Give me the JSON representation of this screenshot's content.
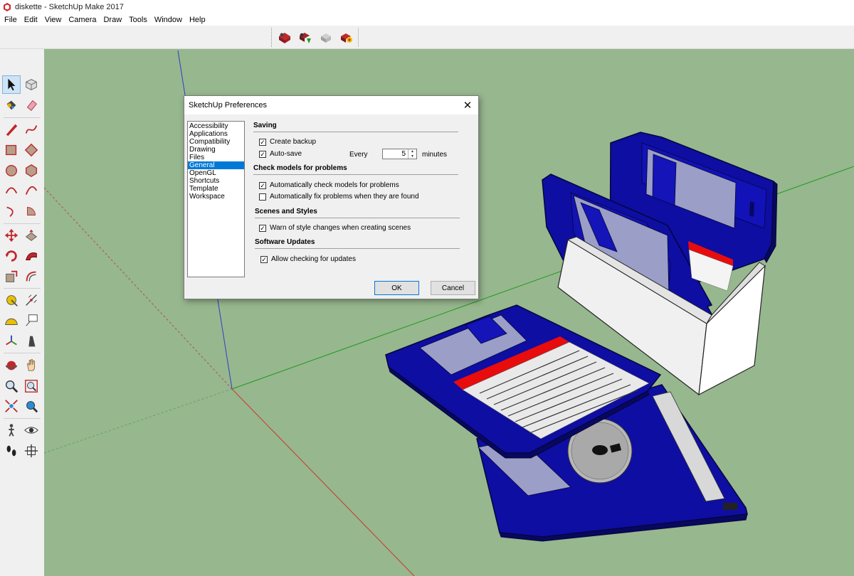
{
  "window": {
    "title": "diskette - SketchUp Make 2017"
  },
  "menu": [
    "File",
    "Edit",
    "View",
    "Camera",
    "Draw",
    "Tools",
    "Window",
    "Help"
  ],
  "top_toolbar": {
    "icons": [
      "warehouse-icon",
      "share-model-icon",
      "share-component-icon",
      "extension-warehouse-icon"
    ]
  },
  "tool_palette": {
    "rows": [
      [
        "select-icon",
        "make-component-icon"
      ],
      [
        "paint-bucket-icon",
        "eraser-icon"
      ],
      "sep",
      [
        "pencil-line-icon",
        "freehand-icon"
      ],
      [
        "rectangle-icon",
        "rotated-rectangle-icon"
      ],
      [
        "circle-icon",
        "polygon-icon"
      ],
      [
        "arc-icon",
        "two-point-arc-icon"
      ],
      [
        "three-point-arc-icon",
        "pie-icon"
      ],
      "sep",
      [
        "move-icon",
        "push-pull-icon"
      ],
      [
        "rotate-icon",
        "follow-me-icon"
      ],
      [
        "scale-icon",
        "offset-icon"
      ],
      "sep",
      [
        "tape-measure-icon",
        "dimension-icon"
      ],
      [
        "protractor-icon",
        "text-icon"
      ],
      [
        "axes-icon",
        "3d-text-icon"
      ],
      "sep",
      [
        "orbit-icon",
        "pan-icon"
      ],
      [
        "zoom-icon",
        "zoom-window-icon"
      ],
      [
        "zoom-extents-icon",
        "previous-view-icon"
      ],
      "sep",
      [
        "walk-icon",
        "look-around-icon"
      ],
      [
        "footprints-icon",
        "section-plane-icon"
      ]
    ]
  },
  "dialog": {
    "title": "SketchUp Preferences",
    "close_glyph": "✕",
    "categories": [
      "Accessibility",
      "Applications",
      "Compatibility",
      "Drawing",
      "Files",
      "General",
      "OpenGL",
      "Shortcuts",
      "Template",
      "Workspace"
    ],
    "selected_category": "General",
    "sections": {
      "saving": {
        "title": "Saving",
        "create_backup": {
          "label": "Create backup",
          "checked": true
        },
        "auto_save": {
          "label": "Auto-save",
          "checked": true
        },
        "every_label": "Every",
        "every_value": "5",
        "minutes_label": "minutes"
      },
      "check_models": {
        "title": "Check models for problems",
        "auto_check": {
          "label": "Automatically check models for problems",
          "checked": true
        },
        "auto_fix": {
          "label": "Automatically fix problems when they are found",
          "checked": false
        }
      },
      "scenes_styles": {
        "title": "Scenes and Styles",
        "warn_style": {
          "label": "Warn of style changes when creating scenes",
          "checked": true
        }
      },
      "software_updates": {
        "title": "Software Updates",
        "allow_updates": {
          "label": "Allow checking for updates",
          "checked": true
        }
      }
    },
    "ok_label": "OK",
    "cancel_label": "Cancel"
  },
  "colors": {
    "viewport_bg": "#97b78e",
    "disk_blue": "#0e0ea3",
    "disk_dark": "#08085e",
    "label_red": "#e80c0c",
    "selection_blue": "#0078d7"
  }
}
